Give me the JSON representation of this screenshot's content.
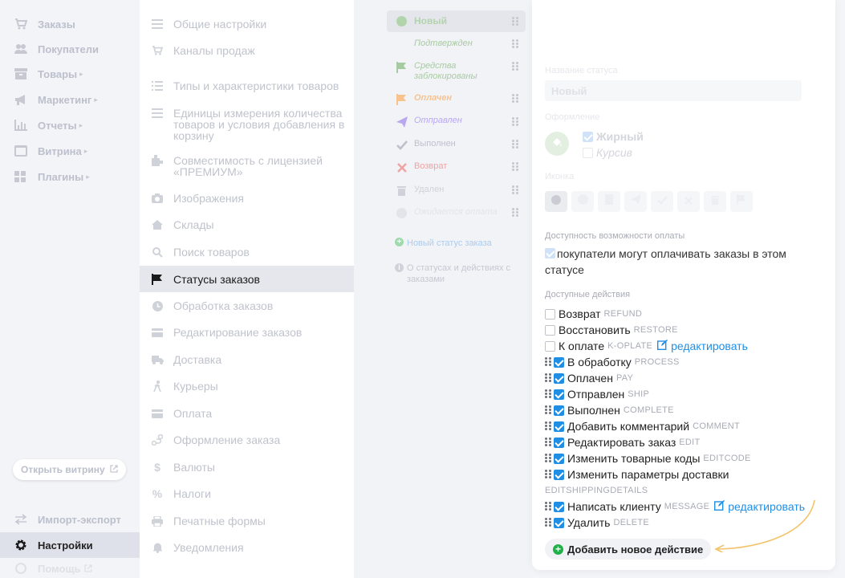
{
  "nav": {
    "items": [
      {
        "label": "Заказы",
        "icon": "cart-icon",
        "chevron": false
      },
      {
        "label": "Покупатели",
        "icon": "users-icon",
        "chevron": false
      },
      {
        "label": "Товары",
        "icon": "box-icon",
        "chevron": true
      },
      {
        "label": "Маркетинг",
        "icon": "megaphone-icon",
        "chevron": true
      },
      {
        "label": "Отчеты",
        "icon": "chart-icon",
        "chevron": true
      },
      {
        "label": "Витрина",
        "icon": "storefront-icon",
        "chevron": true
      },
      {
        "label": "Плагины",
        "icon": "puzzle-icon",
        "chevron": true
      }
    ],
    "open_storefront": "Открыть витрину",
    "import_export": "Импорт-экспорт",
    "settings": "Настройки",
    "help": "Помощь"
  },
  "settings_menu": {
    "items": [
      "Общие настройки",
      "Каналы продаж",
      "Типы и характеристики товаров",
      "Единицы измерения количества товаров и условия добавления в корзину",
      "Совместимость с лицензией «ПРЕМИУМ»",
      "Изображения",
      "Склады",
      "Поиск товаров",
      "Статусы заказов",
      "Обработка заказов",
      "Редактирование заказов",
      "Доставка",
      "Курьеры",
      "Оплата",
      "Оформление заказа",
      "Валюты",
      "Налоги",
      "Печатные формы",
      "Уведомления"
    ]
  },
  "statuses": {
    "items": [
      {
        "label": "Новый",
        "color": "#b2d4ac"
      },
      {
        "label": "Подтвержден",
        "color": "#a7cba0"
      },
      {
        "label": "Средства заблокированы",
        "color": "#a7cba0"
      },
      {
        "label": "Оплачен",
        "color": "#f6c38f"
      },
      {
        "label": "Отправлен",
        "color": "#b9a7f0"
      },
      {
        "label": "Выполнен",
        "color": "#bcc0cb"
      },
      {
        "label": "Возврат",
        "color": "#f0a3a3"
      },
      {
        "label": "Удален",
        "color": "#cfd2d9"
      },
      {
        "label": "Ожидается оплата",
        "color": "#e2e4e9"
      }
    ],
    "new_status": "Новый статус заказа",
    "about": "О статусах и действиях с заказами"
  },
  "editor": {
    "name_label": "Название статуса",
    "name_value": "Новый",
    "style_label": "Оформление",
    "bold": "Жирный",
    "italic": "Курсив",
    "icon_label": "Иконка",
    "payment_label": "Доступность возможности оплаты",
    "payment_text": "покупатели могут оплачивать заказы в этом статусе",
    "actions_label": "Доступные действия",
    "actions": [
      {
        "label": "Возврат",
        "code": "REFUND",
        "checked": false,
        "draggable": false,
        "edit": ""
      },
      {
        "label": "Восстановить",
        "code": "RESTORE",
        "checked": false,
        "draggable": false,
        "edit": ""
      },
      {
        "label": "К оплате",
        "code": "K-OPLATE",
        "checked": false,
        "draggable": false,
        "edit": "редактировать"
      },
      {
        "label": "В обработку",
        "code": "PROCESS",
        "checked": true,
        "draggable": true,
        "edit": ""
      },
      {
        "label": "Оплачен",
        "code": "PAY",
        "checked": true,
        "draggable": true,
        "edit": ""
      },
      {
        "label": "Отправлен",
        "code": "SHIP",
        "checked": true,
        "draggable": true,
        "edit": ""
      },
      {
        "label": "Выполнен",
        "code": "COMPLETE",
        "checked": true,
        "draggable": true,
        "edit": ""
      },
      {
        "label": "Добавить комментарий",
        "code": "COMMENT",
        "checked": true,
        "draggable": true,
        "edit": ""
      },
      {
        "label": "Редактировать заказ",
        "code": "EDIT",
        "checked": true,
        "draggable": true,
        "edit": ""
      },
      {
        "label": "Изменить товарные коды",
        "code": "EDITCODE",
        "checked": true,
        "draggable": true,
        "edit": ""
      },
      {
        "label": "Изменить параметры доставки",
        "code": "",
        "checked": true,
        "draggable": true,
        "edit": ""
      },
      {
        "label": "Написать клиенту",
        "code": "MESSAGE",
        "checked": true,
        "draggable": true,
        "edit": "редактировать"
      },
      {
        "label": "Удалить",
        "code": "DELETE",
        "checked": true,
        "draggable": true,
        "edit": ""
      }
    ],
    "shipping_code": "EDITSHIPPINGDETAILS",
    "add_action": "Добавить новое действие"
  },
  "colors": {
    "accent": "#1f8fe6",
    "add": "#22b04a",
    "arrow": "#f2c36b"
  }
}
